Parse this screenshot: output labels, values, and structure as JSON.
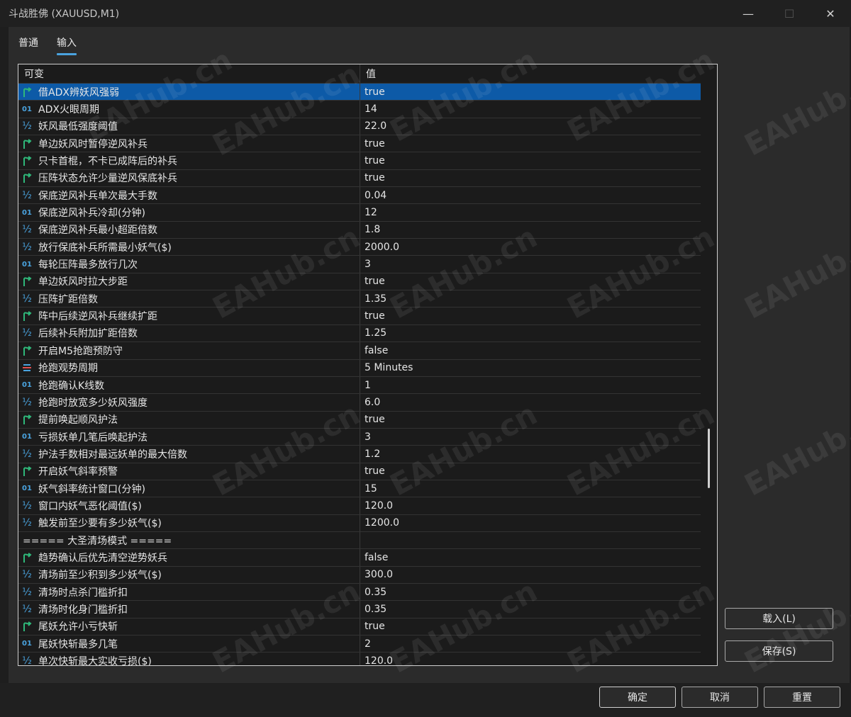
{
  "window": {
    "title": "斗战胜佛 (XAUUSD,M1)"
  },
  "tabs": [
    {
      "label": "普通"
    },
    {
      "label": "输入"
    }
  ],
  "grid": {
    "headers": {
      "name": "可变",
      "value": "值"
    },
    "rows": [
      {
        "icon": "bool-icon",
        "name": "借ADX辨妖风强弱",
        "value": "true"
      },
      {
        "icon": "int-icon",
        "name": "ADX火眼周期",
        "value": "14"
      },
      {
        "icon": "double-icon",
        "name": "妖风最低强度阈值",
        "value": "22.0"
      },
      {
        "icon": "bool-icon",
        "name": "单边妖风时暂停逆风补兵",
        "value": "true"
      },
      {
        "icon": "bool-icon",
        "name": "只卡首棍，不卡已成阵后的补兵",
        "value": "true"
      },
      {
        "icon": "bool-icon",
        "name": "压阵状态允许少量逆风保底补兵",
        "value": "true"
      },
      {
        "icon": "double-icon",
        "name": "保底逆风补兵单次最大手数",
        "value": "0.04"
      },
      {
        "icon": "int-icon",
        "name": "保底逆风补兵冷却(分钟)",
        "value": "12"
      },
      {
        "icon": "double-icon",
        "name": "保底逆风补兵最小超距倍数",
        "value": "1.8"
      },
      {
        "icon": "double-icon",
        "name": "放行保底补兵所需最小妖气($)",
        "value": "2000.0"
      },
      {
        "icon": "int-icon",
        "name": "每轮压阵最多放行几次",
        "value": "3"
      },
      {
        "icon": "bool-icon",
        "name": "单边妖风时拉大步距",
        "value": "true"
      },
      {
        "icon": "double-icon",
        "name": "压阵扩距倍数",
        "value": "1.35"
      },
      {
        "icon": "bool-icon",
        "name": "阵中后续逆风补兵继续扩距",
        "value": "true"
      },
      {
        "icon": "double-icon",
        "name": "后续补兵附加扩距倍数",
        "value": "1.25"
      },
      {
        "icon": "bool-icon",
        "name": "开启M5抢跑预防守",
        "value": "false"
      },
      {
        "icon": "enum-icon",
        "name": "抢跑观势周期",
        "value": "5 Minutes"
      },
      {
        "icon": "int-icon",
        "name": "抢跑确认K线数",
        "value": "1"
      },
      {
        "icon": "double-icon",
        "name": "抢跑时放宽多少妖风强度",
        "value": "6.0"
      },
      {
        "icon": "bool-icon",
        "name": "提前唤起顺风护法",
        "value": "true"
      },
      {
        "icon": "int-icon",
        "name": "亏损妖单几笔后唤起护法",
        "value": "3"
      },
      {
        "icon": "double-icon",
        "name": "护法手数相对最远妖单的最大倍数",
        "value": "1.2"
      },
      {
        "icon": "bool-icon",
        "name": "开启妖气斜率预警",
        "value": "true"
      },
      {
        "icon": "int-icon",
        "name": "妖气斜率统计窗口(分钟)",
        "value": "15"
      },
      {
        "icon": "double-icon",
        "name": "窗口内妖气恶化阈值($)",
        "value": "120.0"
      },
      {
        "icon": "double-icon",
        "name": "触发前至少要有多少妖气($)",
        "value": "1200.0"
      },
      {
        "icon": "",
        "name": "===== 大圣清场模式 =====",
        "value": ""
      },
      {
        "icon": "bool-icon",
        "name": "趋势确认后优先清空逆势妖兵",
        "value": "false"
      },
      {
        "icon": "double-icon",
        "name": "清场前至少积到多少妖气($)",
        "value": "300.0"
      },
      {
        "icon": "double-icon",
        "name": "清场时点杀门槛折扣",
        "value": "0.35"
      },
      {
        "icon": "double-icon",
        "name": "清场时化身门槛折扣",
        "value": "0.35"
      },
      {
        "icon": "bool-icon",
        "name": "尾妖允许小亏快斩",
        "value": "true"
      },
      {
        "icon": "int-icon",
        "name": "尾妖快斩最多几笔",
        "value": "2"
      },
      {
        "icon": "double-icon",
        "name": "单次快斩最大实收亏损($)",
        "value": "120.0"
      }
    ]
  },
  "side_buttons": {
    "load": "载入(L)",
    "save": "保存(S)"
  },
  "footer_buttons": {
    "ok": "确定",
    "cancel": "取消",
    "reset": "重置"
  },
  "watermark_text": "EAHub.cn",
  "colors": {
    "selection": "#0d5aa7",
    "bool_icon": "#2fb87a",
    "int_icon": "#4aa3df",
    "tab_underline": "#4aa3df"
  }
}
